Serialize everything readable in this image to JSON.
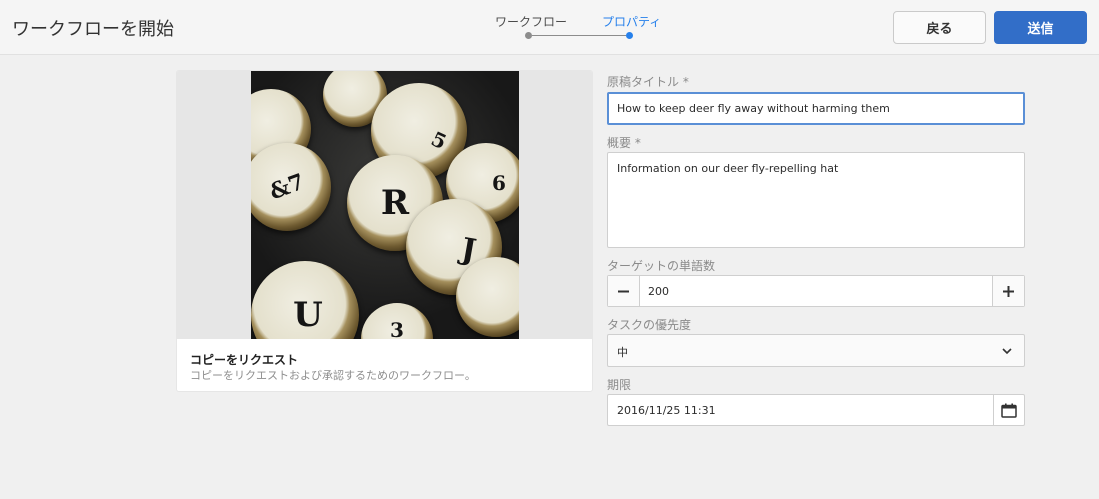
{
  "header": {
    "title": "ワークフローを開始",
    "steps": [
      {
        "label": "ワークフロー",
        "state": "completed"
      },
      {
        "label": "プロパティ",
        "state": "current"
      }
    ],
    "back_label": "戻る",
    "submit_label": "送信"
  },
  "card": {
    "title": "コピーをリクエスト",
    "description": "コピーをリクエストおよび承認するためのワークフロー。",
    "image_keys": [
      "R",
      "J",
      "U",
      "&7",
      "6",
      "5",
      "3"
    ]
  },
  "form": {
    "title_label": "原稿タイトル *",
    "title_value": "How to keep deer fly away without harming them",
    "summary_label": "概要 *",
    "summary_value": "Information on our deer fly-repelling hat",
    "word_count_label": "ターゲットの単語数",
    "word_count_value": "200",
    "priority_label": "タスクの優先度",
    "priority_value": "中",
    "due_label": "期限",
    "due_value": "2016/11/25 11:31"
  },
  "icons": {
    "minus": "minus-icon",
    "plus": "plus-icon",
    "dropdown": "chevron-down-icon",
    "calendar": "calendar-icon"
  },
  "colors": {
    "accent": "#2680eb",
    "primary_button": "#326ec8",
    "focus_border": "#5a8fd6"
  }
}
